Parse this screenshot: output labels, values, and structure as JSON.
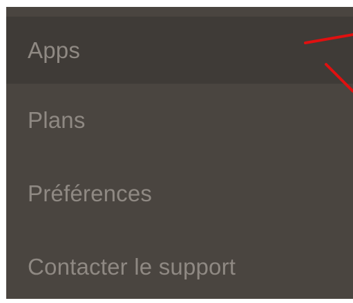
{
  "menu": {
    "items": [
      {
        "label": "Apps",
        "active": true
      },
      {
        "label": "Plans",
        "active": false
      },
      {
        "label": "Préférences",
        "active": false
      },
      {
        "label": "Contacter le support",
        "active": false
      }
    ],
    "colors": {
      "background": "#4a4540",
      "active_background": "#3f3b37",
      "text": "#8f8983",
      "annotation": "#e01010"
    }
  }
}
